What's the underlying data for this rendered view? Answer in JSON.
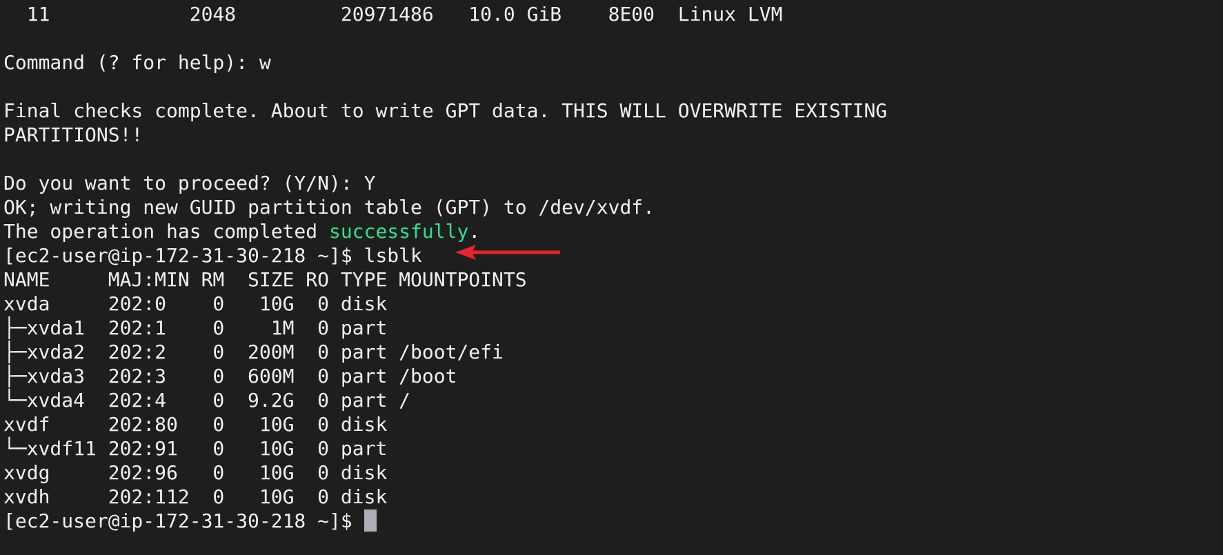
{
  "terminal": {
    "lines": {
      "l01": "  11            2048         20971486   10.0 GiB    8E00  Linux LVM",
      "l02": "",
      "l03": "Command (? for help): w",
      "l04": "",
      "l05": "Final checks complete. About to write GPT data. THIS WILL OVERWRITE EXISTING",
      "l06": "PARTITIONS!!",
      "l07": "",
      "l08": "Do you want to proceed? (Y/N): Y",
      "l09": "OK; writing new GUID partition table (GPT) to /dev/xvdf.",
      "l10_prefix": "The operation has completed ",
      "l10_highlight": "successfully",
      "l10_suffix": ".",
      "l11": "[ec2-user@ip-172-31-30-218 ~]$ lsblk",
      "l12": "NAME     MAJ:MIN RM  SIZE RO TYPE MOUNTPOINTS",
      "l13": "xvda     202:0    0   10G  0 disk",
      "l14": "├─xvda1  202:1    0    1M  0 part",
      "l15": "├─xvda2  202:2    0  200M  0 part /boot/efi",
      "l16": "├─xvda3  202:3    0  600M  0 part /boot",
      "l17": "└─xvda4  202:4    0  9.2G  0 part /",
      "l18": "xvdf     202:80   0   10G  0 disk",
      "l19": "└─xvdf11 202:91   0   10G  0 part",
      "l20": "xvdg     202:96   0   10G  0 disk",
      "l21": "xvdh     202:112  0   10G  0 disk",
      "l22": "[ec2-user@ip-172-31-30-218 ~]$ "
    }
  },
  "colors": {
    "background": "#1e1e1e",
    "foreground": "#f0f0f0",
    "success_green": "#2ee28a",
    "annotation_arrow": "#e8242a",
    "cursor": "#aeaeb8"
  },
  "icons": {
    "annotation": "red-arrow-icon",
    "cursor": "block-cursor"
  }
}
